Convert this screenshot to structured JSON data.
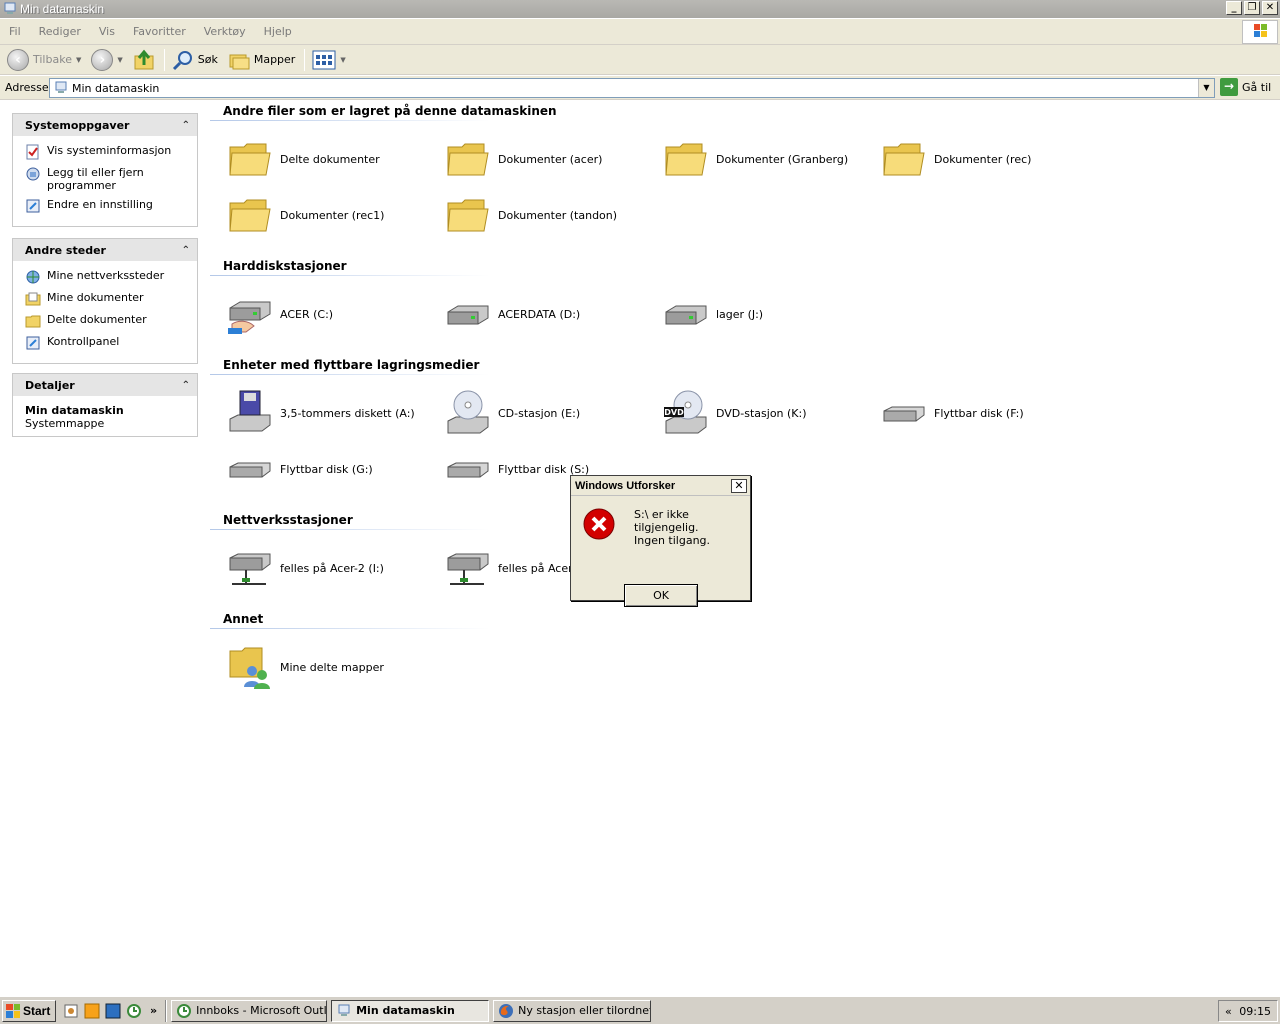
{
  "window": {
    "title": "Min datamaskin",
    "controls": {
      "minimize": "_",
      "restore": "❐",
      "close": "✕"
    }
  },
  "menu": [
    "Fil",
    "Rediger",
    "Vis",
    "Favoritter",
    "Verktøy",
    "Hjelp"
  ],
  "toolbar": {
    "back": "Tilbake",
    "search": "Søk",
    "folders": "Mapper"
  },
  "address": {
    "label": "Adresse",
    "value": "Min datamaskin",
    "go": "Gå til"
  },
  "sidebar": {
    "tasks": {
      "title": "Systemoppgaver",
      "items": [
        "Vis systeminformasjon",
        "Legg til eller fjern programmer",
        "Endre en innstilling"
      ]
    },
    "places": {
      "title": "Andre steder",
      "items": [
        "Mine nettverkssteder",
        "Mine dokumenter",
        "Delte dokumenter",
        "Kontrollpanel"
      ]
    },
    "details": {
      "title": "Detaljer",
      "name": "Min datamaskin",
      "type": "Systemmappe"
    }
  },
  "sections": {
    "files": {
      "title": "Andre filer som er lagret på denne datamaskinen",
      "items": [
        "Delte dokumenter",
        "Dokumenter (acer)",
        "Dokumenter (Granberg)",
        "Dokumenter (rec)",
        "Dokumenter (rec1)",
        "Dokumenter (tandon)"
      ]
    },
    "hdd": {
      "title": "Harddiskstasjoner",
      "items": [
        "ACER (C:)",
        "ACERDATA (D:)",
        "lager (J:)"
      ]
    },
    "removable": {
      "title": "Enheter med flyttbare lagringsmedier",
      "items": [
        "3,5-tommers diskett (A:)",
        "CD-stasjon (E:)",
        "DVD-stasjon (K:)",
        "Flyttbar disk (F:)",
        "Flyttbar disk (G:)",
        "Flyttbar disk (S:)"
      ]
    },
    "network": {
      "title": "Nettverksstasjoner",
      "items": [
        "felles på Acer-2 (I:)",
        "felles på Acer-2"
      ]
    },
    "other": {
      "title": "Annet",
      "items": [
        "Mine delte mapper"
      ]
    }
  },
  "dialog": {
    "title": "Windows Utforsker",
    "close": "✕",
    "line1": "S:\\ er ikke tilgjengelig.",
    "line2": "Ingen tilgang.",
    "ok": "OK"
  },
  "taskbar": {
    "start": "Start",
    "overflow": "»",
    "tasks": [
      "Innboks - Microsoft Outlook",
      "Min datamaskin",
      "Ny stasjon eller tilordnet ..."
    ],
    "tray_expand": "«",
    "clock": "09:15"
  },
  "colors": {
    "title_inactive": "#a9a8a3",
    "chrome": "#ece9d8",
    "panel_header": "#e5e5e5",
    "error_red": "#d20000"
  }
}
